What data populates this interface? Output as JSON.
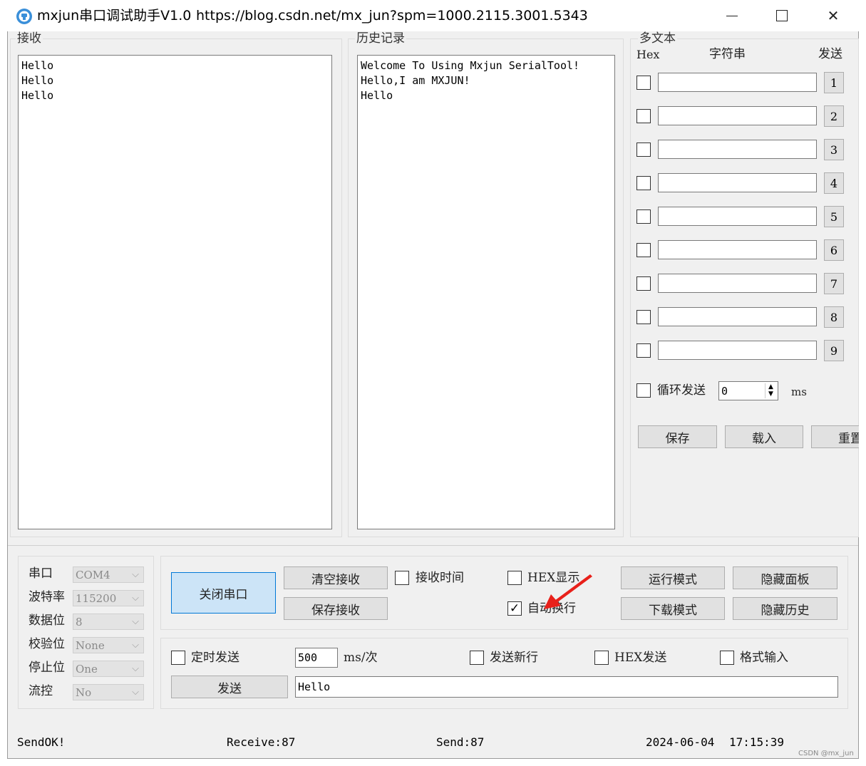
{
  "window": {
    "app_title": "mxjun串口调试助手V1.0",
    "url": "https://blog.csdn.net/mx_jun?spm=1000.2115.3001.5343"
  },
  "receive": {
    "label": "接收",
    "lines": "Hello\nHello\nHello"
  },
  "history": {
    "label": "历史记录",
    "lines": "Welcome To Using Mxjun SerialTool!\nHello,I am MXJUN!\nHello"
  },
  "multi": {
    "label": "多文本",
    "col_hex": "Hex",
    "col_string": "字符串",
    "col_send": "发送",
    "rows": [
      "1",
      "2",
      "3",
      "4",
      "5",
      "6",
      "7",
      "8",
      "9"
    ],
    "loop_label": "循环发送",
    "loop_value": "0",
    "loop_unit": "ms",
    "save": "保存",
    "load": "载入",
    "reset": "重置"
  },
  "port": {
    "port_label": "串口",
    "port_value": "COM4",
    "baud_label": "波特率",
    "baud_value": "115200",
    "data_label": "数据位",
    "data_value": "8",
    "parity_label": "校验位",
    "parity_value": "None",
    "stop_label": "停止位",
    "stop_value": "One",
    "flow_label": "流控",
    "flow_value": "No"
  },
  "controls": {
    "close_port": "关闭串口",
    "clear_recv": "清空接收",
    "save_recv": "保存接收",
    "recv_time": "接收时间",
    "hex_show": "HEX显示",
    "auto_wrap": "自动换行",
    "run_mode": "运行模式",
    "download_mode": "下载模式",
    "hide_panel": "隐藏面板",
    "hide_history": "隐藏历史"
  },
  "send": {
    "timed_send": "定时发送",
    "interval": "500",
    "interval_unit": "ms/次",
    "send_newline": "发送新行",
    "hex_send": "HEX发送",
    "format_input": "格式输入",
    "send_button": "发送",
    "send_text": "Hello"
  },
  "statusbar": {
    "msg": "SendOK!",
    "receive": "Receive:87",
    "send": "Send:87",
    "date": "2024-06-04",
    "time": "17:15:39"
  },
  "watermark": "CSDN @mx_jun",
  "icons": {
    "app": "app-icon",
    "minimize": "minimize-icon",
    "maximize": "maximize-icon",
    "close": "close-icon",
    "arrow": "red-arrow-annotation"
  },
  "colors": {
    "primary_button": "#cce4f7",
    "primary_border": "#0078d7",
    "annotation": "#e8201a"
  }
}
